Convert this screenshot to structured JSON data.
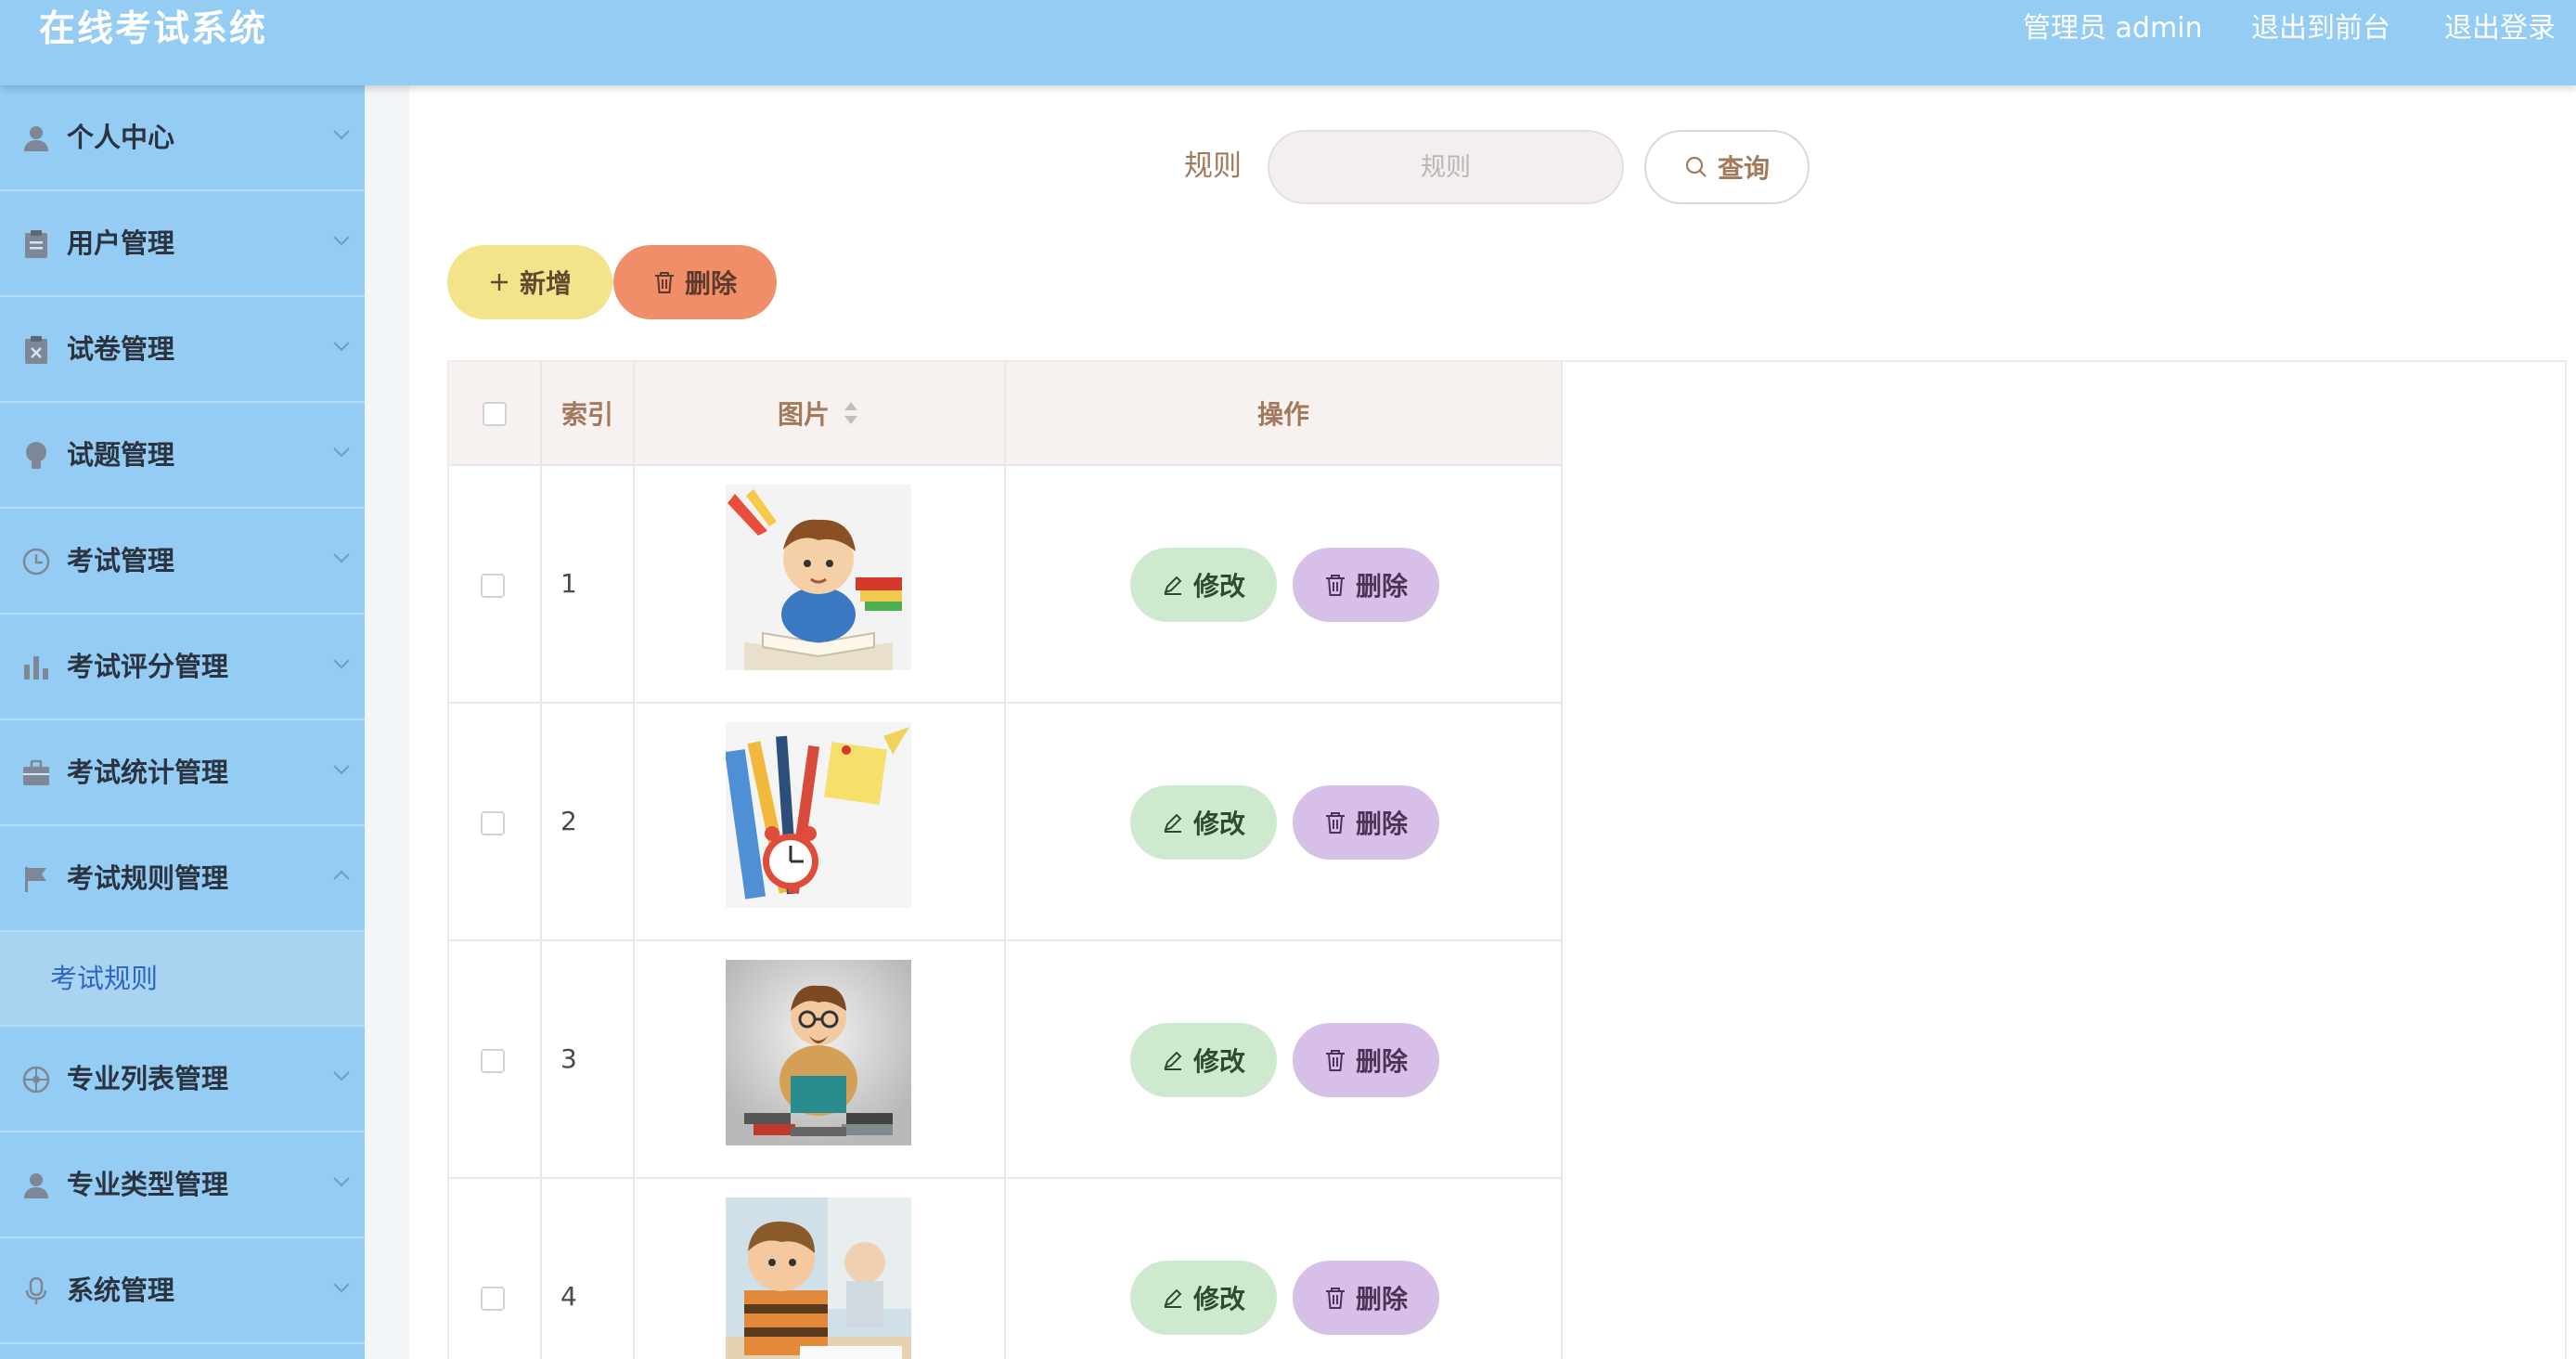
{
  "header": {
    "title": "在线考试系统",
    "user_label": "管理员 admin",
    "to_front": "退出到前台",
    "logout": "退出登录"
  },
  "sidebar": {
    "items": [
      {
        "label": "个人中心",
        "icon": "user-icon"
      },
      {
        "label": "用户管理",
        "icon": "clipboard-icon"
      },
      {
        "label": "试卷管理",
        "icon": "paper-icon"
      },
      {
        "label": "试题管理",
        "icon": "bulb-icon"
      },
      {
        "label": "考试管理",
        "icon": "clock-icon"
      },
      {
        "label": "考试评分管理",
        "icon": "bar-chart-icon"
      },
      {
        "label": "考试统计管理",
        "icon": "briefcase-icon"
      },
      {
        "label": "考试规则管理",
        "icon": "flag-icon"
      },
      {
        "label": "专业列表管理",
        "icon": "compass-icon"
      },
      {
        "label": "专业类型管理",
        "icon": "user-icon"
      },
      {
        "label": "系统管理",
        "icon": "microphone-icon"
      }
    ],
    "submenu": {
      "label": "考试规则"
    }
  },
  "search": {
    "label": "规则",
    "placeholder": "规则",
    "query_label": "查询"
  },
  "toolbar": {
    "add_label": "新增",
    "delete_label": "删除"
  },
  "table": {
    "columns": {
      "index": "索引",
      "image": "图片",
      "actions": "操作"
    },
    "rows": [
      {
        "index": "1",
        "image": "boy-reading-image"
      },
      {
        "index": "2",
        "image": "stationery-clock-image"
      },
      {
        "index": "3",
        "image": "man-reading-books-image"
      },
      {
        "index": "4",
        "image": "student-classroom-image"
      }
    ],
    "edit_label": "修改",
    "delete_label": "删除"
  },
  "colors": {
    "header_bg": "#94ccf4",
    "sidebar_bg": "#94ccf4",
    "accent_text": "#a3795c",
    "add_button": "#f3e48c",
    "delete_button": "#f18e6a",
    "edit_row_button": "#cfe9cf",
    "delete_row_button": "#d8bfe8"
  }
}
